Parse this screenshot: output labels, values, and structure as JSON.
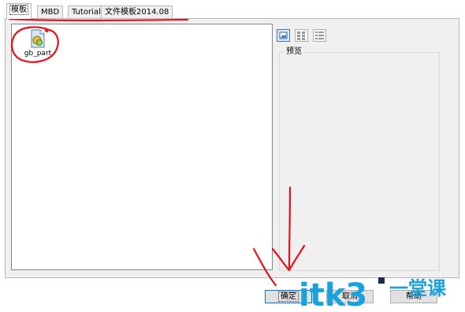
{
  "tabs": [
    {
      "label": "模板",
      "active": true
    },
    {
      "label": "MBD",
      "active": false
    },
    {
      "label": "Tutorial",
      "active": false
    },
    {
      "label": "文件模板2014.08",
      "active": false
    }
  ],
  "file_list": {
    "items": [
      {
        "name": "gb_part",
        "icon": "document-icon"
      }
    ]
  },
  "view_buttons": [
    {
      "icon": "large-icons-view-icon",
      "selected": true
    },
    {
      "icon": "list-view-icon",
      "selected": false
    },
    {
      "icon": "details-view-icon",
      "selected": false
    }
  ],
  "preview": {
    "label": "预览"
  },
  "buttons": {
    "ok": "确定",
    "cancel": "取消",
    "help": "帮助"
  },
  "watermark": {
    "text_main": "itk3",
    "text_side": "一堂课",
    "colors": {
      "main": "#1ba2dd",
      "dot": "#1a2b4a"
    }
  },
  "annotation_color": "#e8101a"
}
